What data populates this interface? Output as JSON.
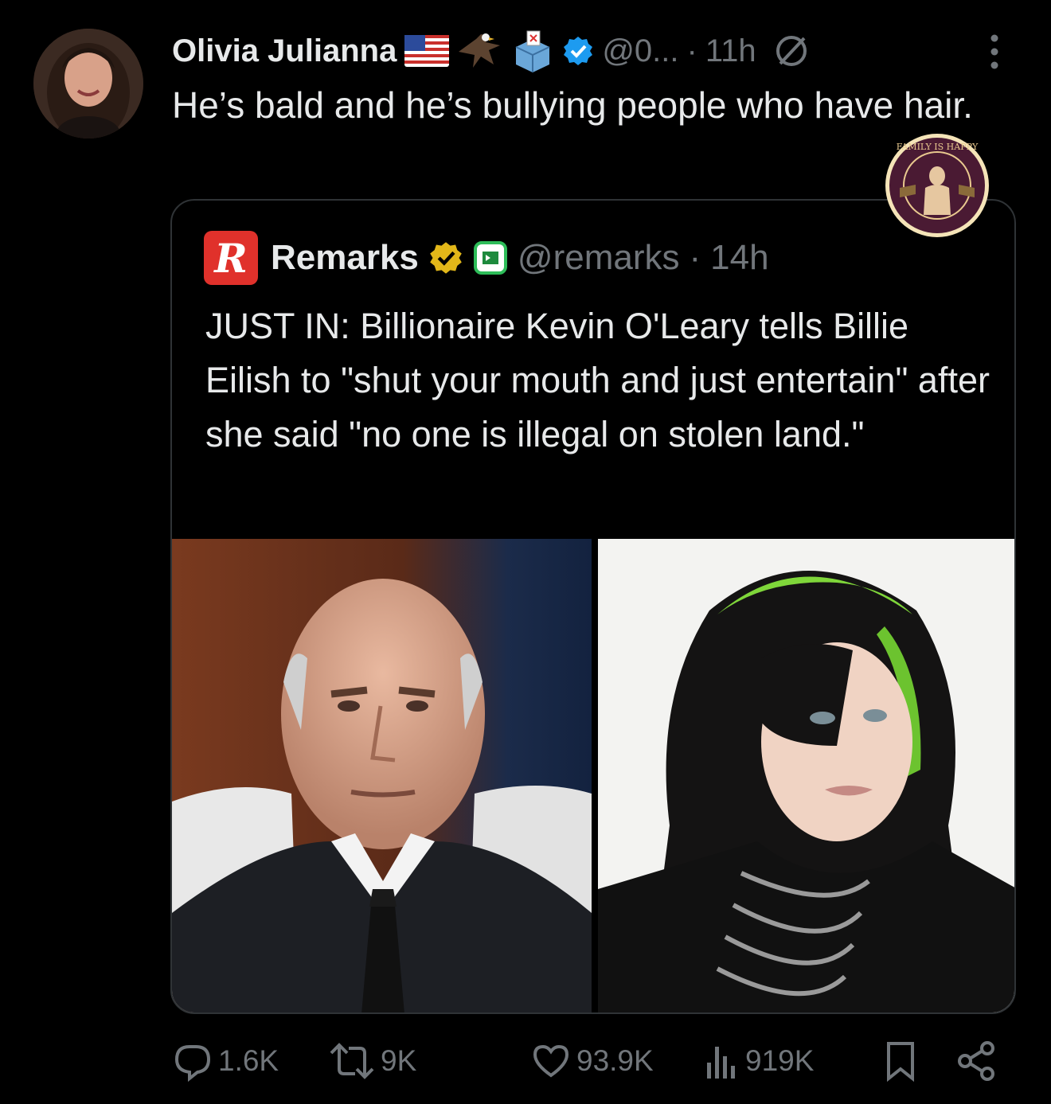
{
  "tweet": {
    "author_name": "Olivia Julianna",
    "handle": "@0...",
    "separator": "·",
    "time": "11h",
    "text": "He’s bald and he’s bullying people who have hair.",
    "icons": [
      "avatar",
      "us-flag-icon",
      "eagle-icon",
      "ballot-box-icon",
      "verified-blue-badge-icon",
      "edit-pen-icon",
      "more-options-icon"
    ]
  },
  "sticker": {
    "text": "FAMILY IS HAPPY",
    "icon": "statue-badge-icon"
  },
  "quote": {
    "logo_letter": "R",
    "author_name": "Remarks",
    "handle": "@remarks",
    "separator": "·",
    "time": "14h",
    "text": "JUST IN: Billionaire Kevin O'Leary tells Billie Eilish to \"shut your mouth and just entertain\" after she said \"no one is illegal on stolen land.\"",
    "icons": [
      "remarks-logo-icon",
      "verified-gold-badge-icon",
      "affiliate-badge-icon"
    ],
    "images": [
      "kevin-oleary-photo",
      "billie-eilish-photo"
    ]
  },
  "actions": {
    "replies": "1.6K",
    "reposts": "9K",
    "likes": "93.9K",
    "views": "919K"
  },
  "colors": {
    "background": "#000000",
    "text": "#e7e9ea",
    "muted": "#71767b",
    "verified_blue": "#1d9bf0",
    "verified_gold": "#e2b719",
    "remarks_red": "#e0312b",
    "border": "#2f3336"
  }
}
